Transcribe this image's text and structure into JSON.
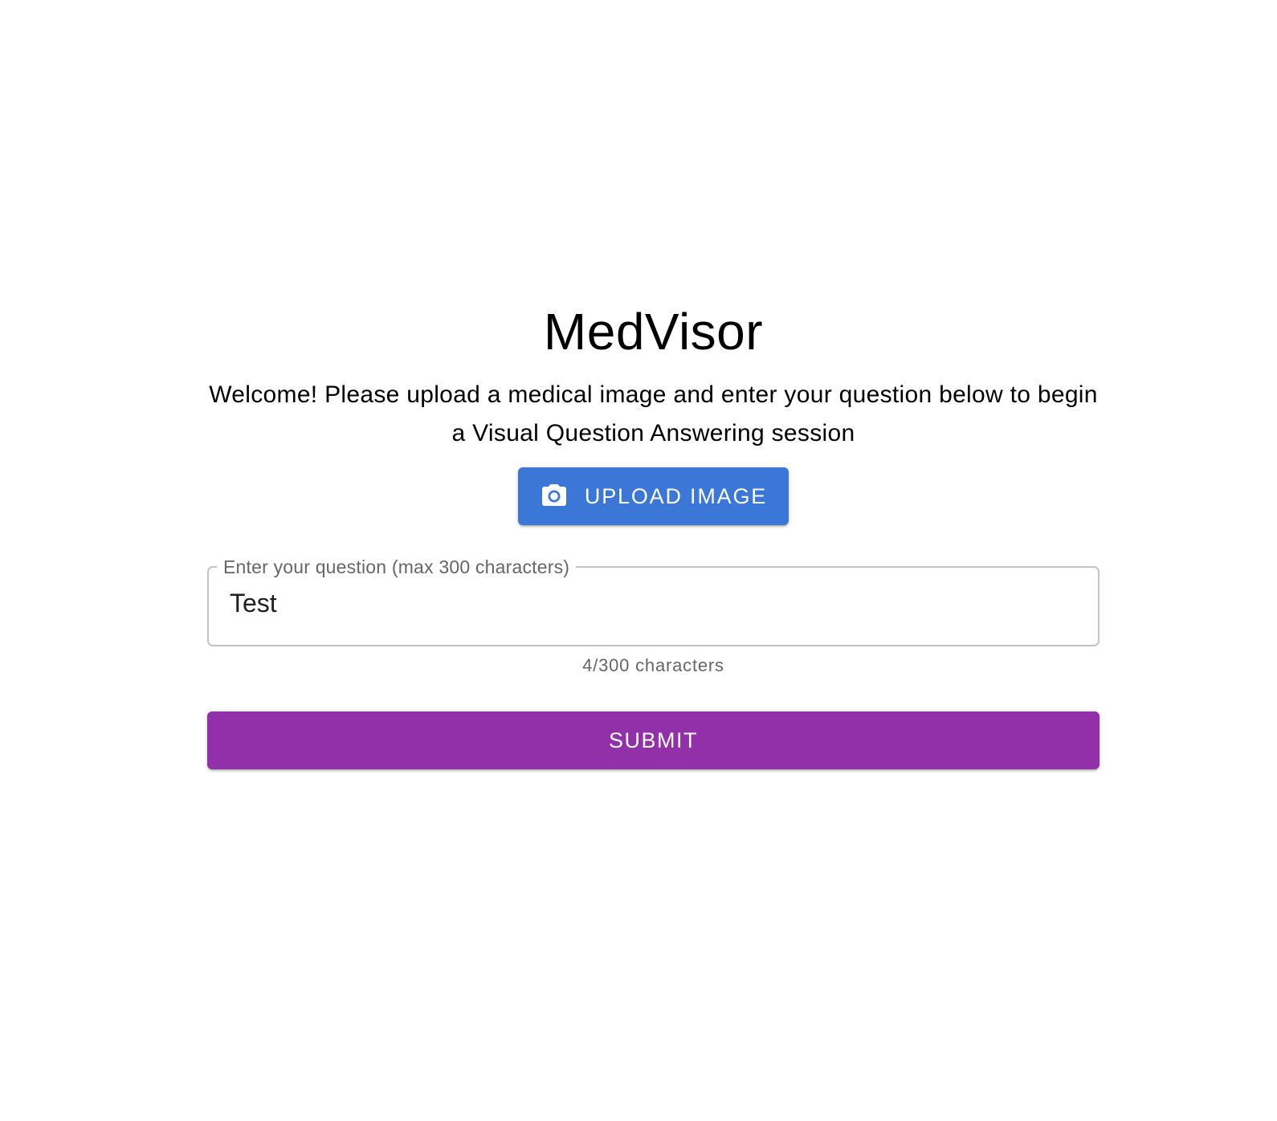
{
  "app": {
    "title": "MedVisor",
    "welcome": "Welcome! Please upload a medical image and enter your question below to begin a Visual Question Answering session"
  },
  "upload": {
    "label": "UPLOAD IMAGE",
    "icon": "camera-icon",
    "color": "#3a77d6"
  },
  "question": {
    "label": "Enter your question (max 300 characters)",
    "value": "Test",
    "counter": "4/300 characters"
  },
  "submit": {
    "label": "SUBMIT",
    "color": "#9130a8"
  }
}
